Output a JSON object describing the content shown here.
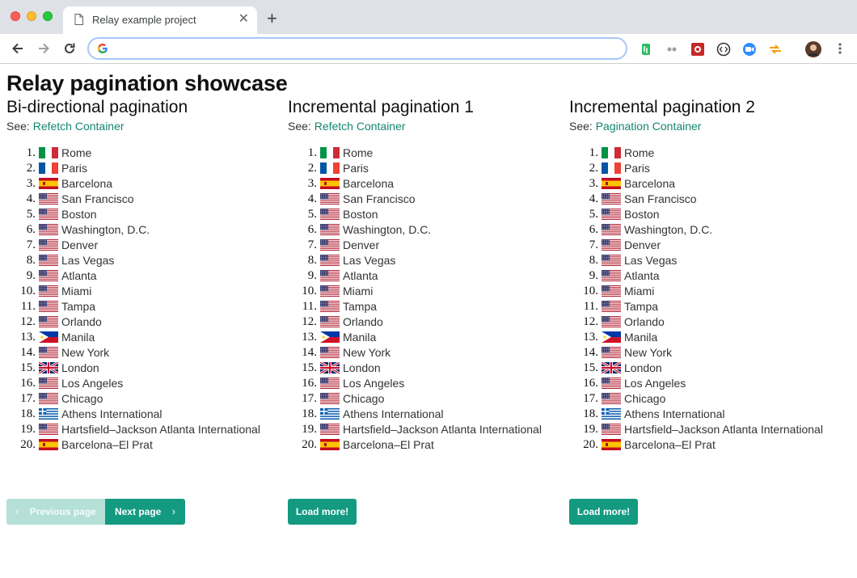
{
  "browser": {
    "tab_title": "Relay example project",
    "tab_close": "✕",
    "new_tab": "+",
    "address": ""
  },
  "page": {
    "title": "Relay pagination showcase",
    "see_label": "See: "
  },
  "columns": [
    {
      "heading": "Bi-directional pagination",
      "link": "Refetch Container",
      "buttons": {
        "previous": "Previous page",
        "next": "Next page"
      }
    },
    {
      "heading": "Incremental pagination 1",
      "link": "Refetch Container",
      "buttons": {
        "load": "Load more!"
      }
    },
    {
      "heading": "Incremental pagination 2",
      "link": "Pagination Container",
      "buttons": {
        "load": "Load more!"
      }
    }
  ],
  "cities": [
    {
      "num": "1.",
      "name": "Rome",
      "flag": "it"
    },
    {
      "num": "2.",
      "name": "Paris",
      "flag": "fr"
    },
    {
      "num": "3.",
      "name": "Barcelona",
      "flag": "es"
    },
    {
      "num": "4.",
      "name": "San Francisco",
      "flag": "us"
    },
    {
      "num": "5.",
      "name": "Boston",
      "flag": "us"
    },
    {
      "num": "6.",
      "name": "Washington, D.C.",
      "flag": "us"
    },
    {
      "num": "7.",
      "name": "Denver",
      "flag": "us"
    },
    {
      "num": "8.",
      "name": "Las Vegas",
      "flag": "us"
    },
    {
      "num": "9.",
      "name": "Atlanta",
      "flag": "us"
    },
    {
      "num": "10.",
      "name": "Miami",
      "flag": "us"
    },
    {
      "num": "11.",
      "name": "Tampa",
      "flag": "us"
    },
    {
      "num": "12.",
      "name": "Orlando",
      "flag": "us"
    },
    {
      "num": "13.",
      "name": "Manila",
      "flag": "ph"
    },
    {
      "num": "14.",
      "name": "New York",
      "flag": "us"
    },
    {
      "num": "15.",
      "name": "London",
      "flag": "gb"
    },
    {
      "num": "16.",
      "name": "Los Angeles",
      "flag": "us"
    },
    {
      "num": "17.",
      "name": "Chicago",
      "flag": "us"
    },
    {
      "num": "18.",
      "name": "Athens International",
      "flag": "gr"
    },
    {
      "num": "19.",
      "name": "Hartsfield–Jackson Atlanta International",
      "flag": "us"
    },
    {
      "num": "20.",
      "name": "Barcelona–El Prat",
      "flag": "es"
    }
  ],
  "colors": {
    "accent": "#149a81",
    "accent_disabled": "#b4e0d8",
    "link": "#12876f"
  }
}
